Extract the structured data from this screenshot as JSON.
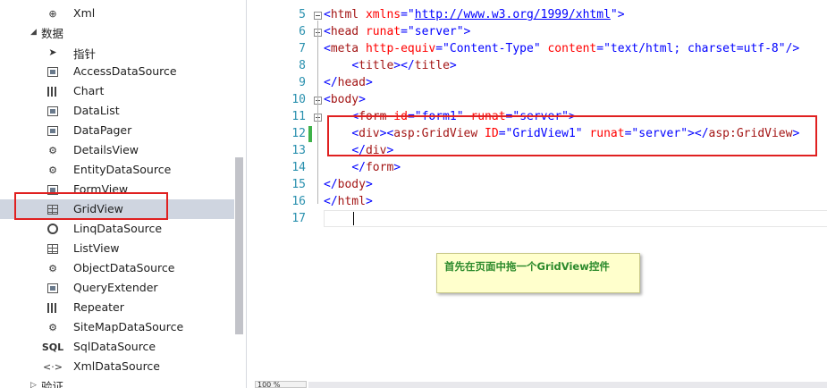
{
  "toolbox": {
    "items_top": [
      {
        "label": "Xml",
        "icon": "xml-control-icon"
      }
    ],
    "group_data": {
      "label": "数据",
      "arrow": "◢"
    },
    "data_items": [
      {
        "label": "指针",
        "icon": "pointer-icon"
      },
      {
        "label": "AccessDataSource",
        "icon": "datasource-icon"
      },
      {
        "label": "Chart",
        "icon": "chart-icon"
      },
      {
        "label": "DataList",
        "icon": "datalist-icon"
      },
      {
        "label": "DataPager",
        "icon": "datapager-icon"
      },
      {
        "label": "DetailsView",
        "icon": "detailsview-icon"
      },
      {
        "label": "EntityDataSource",
        "icon": "entity-datasource-icon"
      },
      {
        "label": "FormView",
        "icon": "formview-icon"
      },
      {
        "label": "GridView",
        "icon": "gridview-icon"
      },
      {
        "label": "LinqDataSource",
        "icon": "linq-datasource-icon"
      },
      {
        "label": "ListView",
        "icon": "listview-icon"
      },
      {
        "label": "ObjectDataSource",
        "icon": "object-datasource-icon"
      },
      {
        "label": "QueryExtender",
        "icon": "query-extender-icon"
      },
      {
        "label": "Repeater",
        "icon": "repeater-icon"
      },
      {
        "label": "SiteMapDataSource",
        "icon": "sitemap-datasource-icon"
      },
      {
        "label": "SqlDataSource",
        "icon": "sql-datasource-icon",
        "glyph": "SQL"
      },
      {
        "label": "XmlDataSource",
        "icon": "xml-datasource-icon",
        "glyph": "<·>"
      }
    ],
    "group_validation": {
      "label": "验证",
      "arrow": "▷"
    },
    "selected": "GridView"
  },
  "editor": {
    "line_numbers": [
      "5",
      "6",
      "7",
      "8",
      "9",
      "10",
      "11",
      "12",
      "13",
      "14",
      "15",
      "16",
      "17"
    ],
    "lines": {
      "l5": {
        "lt": "<",
        "tag": "html",
        "attr": " xmlns",
        "eq": "=\"",
        "link": "http://www.w3.org/1999/xhtml",
        "end": "\">"
      },
      "l6": {
        "lt": "<",
        "tag": "head",
        "attr": " runat",
        "eq": "=\"",
        "val": "server",
        "end": "\">"
      },
      "l7": {
        "lt": "<",
        "tag": "meta",
        "attr1": " http-equiv",
        "eq1": "=\"",
        "val1": "Content-Type",
        "q1": "\"",
        "attr2": " content",
        "eq2": "=\"",
        "val2": "text/html; charset=utf-8",
        "end": "\"/>"
      },
      "l8": {
        "indent": "    ",
        "lt": "<",
        "tag": "title",
        "mid": "></",
        "tag2": "title",
        "end": ">"
      },
      "l9": {
        "lt": "</",
        "tag": "head",
        "end": ">"
      },
      "l10": {
        "lt": "<",
        "tag": "body",
        "end": ">"
      },
      "l11": {
        "indent": "    ",
        "lt": "<",
        "tag": "form",
        "attr1": " id",
        "eq1": "=\"",
        "val1": "form1",
        "q1": "\"",
        "attr2": " runat",
        "eq2": "=\"",
        "val2": "server",
        "end": "\">"
      },
      "l12": {
        "indent": "    ",
        "lt": "<",
        "tag": "div",
        "gt": "><",
        "tag2": "asp:GridView",
        "attr1": " ID",
        "eq1": "=\"",
        "val1": "GridView1",
        "q1": "\"",
        "attr2": " runat",
        "eq2": "=\"",
        "val2": "server",
        "mid": "\"></",
        "tag3": "asp:GridView",
        "end": ">"
      },
      "l13": {
        "indent": "    ",
        "lt": "</",
        "tag": "div",
        "end": ">"
      },
      "l14": {
        "indent": "    ",
        "lt": "</",
        "tag": "form",
        "end": ">"
      },
      "l15": {
        "lt": "</",
        "tag": "body",
        "end": ">"
      },
      "l16": {
        "lt": "</",
        "tag": "html",
        "end": ">"
      }
    },
    "zoom": "100 %"
  },
  "note": {
    "text": "首先在页面中拖一个GridView控件"
  },
  "colors": {
    "tag": "#a31515",
    "attr": "#ff0000",
    "value": "#0000ff",
    "line_number": "#2b91af",
    "highlight_box": "#e02020",
    "note_bg": "#ffffcc",
    "note_text": "#2b8a2b"
  }
}
